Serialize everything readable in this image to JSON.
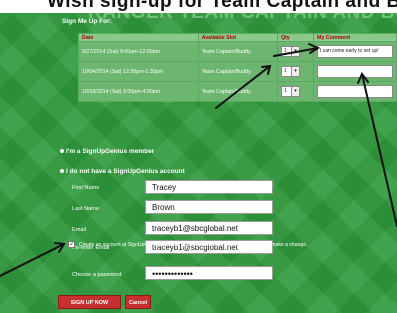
{
  "screen_title": "Wish sign-up for Team Captain and Buddy",
  "banner": "RANGER TEAM CAPTAIN AND BUDDY SIGN UP",
  "section_label": "Sign Me Up For:",
  "table": {
    "columns": [
      "Date",
      "Available Slot",
      "Qty",
      "My Comment"
    ],
    "rows": [
      {
        "date": "9/27/2014 (Sat) 9:00am-12:00am",
        "slot": "Team Captain/Buddy",
        "qty": "1",
        "comment": "I can come early to set up!"
      },
      {
        "date": "10/04/2014 (Sat) 12:30pm-1:30pm",
        "slot": "Team Captain/Buddy",
        "qty": "1",
        "comment": ""
      },
      {
        "date": "10/18/2014 (Sat) 3:00pm-4:00pm",
        "slot": "Team Captain/Buddy",
        "qty": "1",
        "comment": ""
      }
    ]
  },
  "member_option": "I'm a SignUpGenius member",
  "nonmember_option": "I do not have a SignUpGenius account",
  "form": {
    "first_name_label": "First Name",
    "first_name": "Tracey",
    "last_name_label": "Last Name",
    "last_name": "Brown",
    "email_label": "Email",
    "email": "traceyb1@sbcglobal.net",
    "reemail_label": "Re-enter Email",
    "reemail": "traceyb1@sbcglobal.net",
    "create_account_text": "Create an account at SignUpGenius so I can login and edit my items if I ever need to make a change.",
    "password_label": "Choose a password",
    "password": "•••••••••••••"
  },
  "buttons": {
    "signup": "SIGN UP NOW",
    "cancel": "Cancel"
  },
  "colors": {
    "background": "#2f9a3c",
    "header_text": "#b00000",
    "button": "#c83030"
  }
}
